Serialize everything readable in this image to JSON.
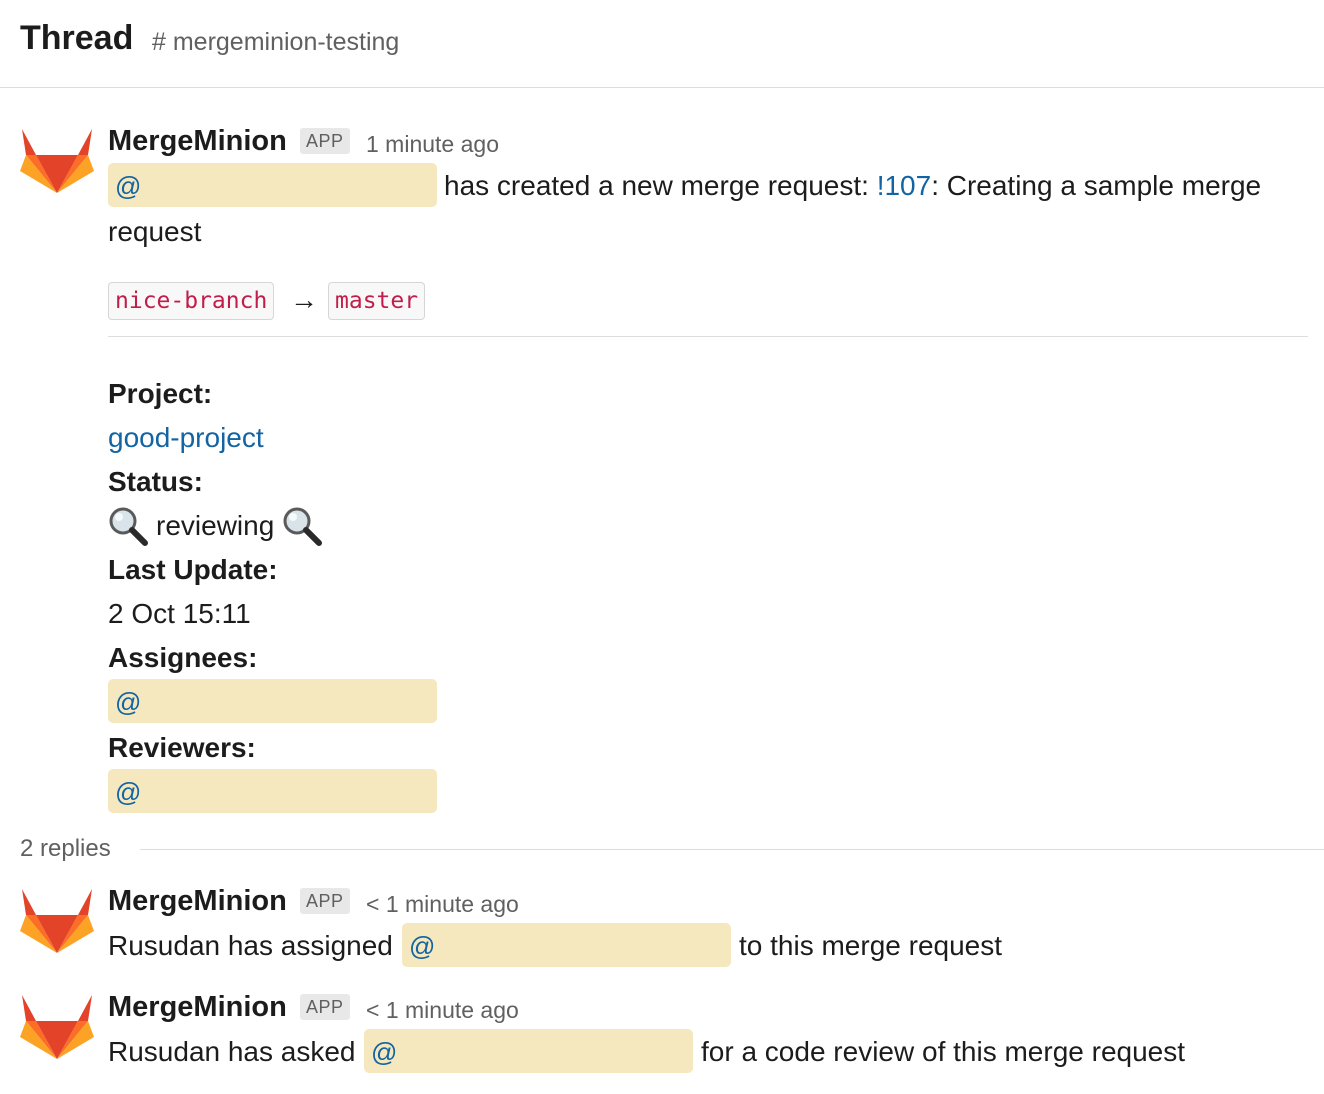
{
  "header": {
    "title": "Thread",
    "channel": "# mergeminion-testing"
  },
  "main_message": {
    "sender": "MergeMinion",
    "badge": "APP",
    "time": "1 minute ago",
    "mention_prefix": "@",
    "text_before_link": "has created a new merge request: ",
    "mr_link": "!107",
    "text_after_link": ": Creating a sample merge",
    "text_wrap": "request",
    "source_branch": "nice-branch",
    "arrow": "→",
    "target_branch": "master",
    "fields": {
      "project_label": "Project:",
      "project_value": "good-project",
      "status_label": "Status:",
      "status_value": "reviewing",
      "last_update_label": "Last Update:",
      "last_update_value": "2 Oct 15:11",
      "assignees_label": "Assignees:",
      "assignees_mention": "@",
      "reviewers_label": "Reviewers:",
      "reviewers_mention": "@"
    }
  },
  "replies_count": "2 replies",
  "replies": [
    {
      "sender": "MergeMinion",
      "badge": "APP",
      "time": "< 1 minute ago",
      "text_before": "Rusudan has assigned",
      "mention": "@",
      "text_after": "to this merge request"
    },
    {
      "sender": "MergeMinion",
      "badge": "APP",
      "time": "< 1 minute ago",
      "text_before": "Rusudan has asked",
      "mention": "@",
      "text_after": "for a code review of this merge request"
    }
  ],
  "icons": {
    "avatar": "gitlab-fox-icon",
    "status": "magnifying-glass-icon"
  },
  "colors": {
    "link": "#1264a3",
    "mention_bg": "#f6e8be",
    "code": "#c21d4a"
  }
}
